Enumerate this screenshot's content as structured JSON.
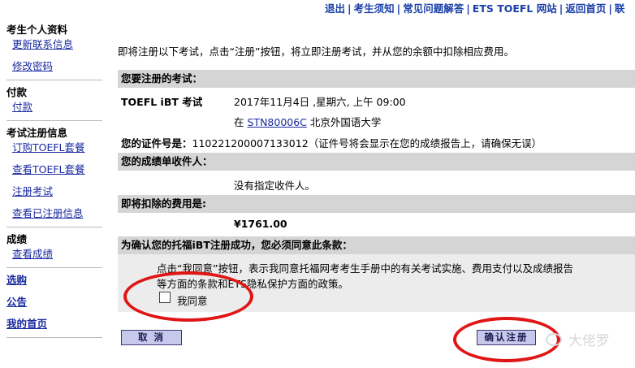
{
  "topnav": [
    "退出",
    "考生须知",
    "常见问题解答",
    "ETS TOEFL 网站",
    "返回首页",
    "联"
  ],
  "sidebar": {
    "profile_head": "考生个人资料",
    "update_contact": "更新联系信息",
    "change_password": "修改密码",
    "payment_head": "付款",
    "pay": "付款",
    "register_head": "考试注册信息",
    "order_toefl": "订购TOEFL套餐",
    "view_toefl": "查看TOEFL套餐",
    "register_exam": "注册考试",
    "view_registered": "查看已注册信息",
    "scores_head": "成绩",
    "view_scores": "查看成绩",
    "elective": "选购",
    "notice": "公告",
    "my_home": "我的首页"
  },
  "main": {
    "intro": "即将注册以下考试，点击“注册”按钮，将立即注册考试，并从您的余额中扣除相应费用。",
    "exam_head": "您要注册的考试：",
    "exam_name": "TOEFL iBT 考试",
    "exam_datetime": "2017年11月4日 ,星期六, 上午 09:00",
    "at": "在",
    "center_code": "STN80006C",
    "center_name": "北京外国语大学",
    "id_label": "您的证件号是：",
    "id_value": "110221200007133012（证件号将会显示在您的成绩报告上，请确保无误）",
    "recipients_head": "您的成绩单收件人：",
    "recipients_value": "没有指定收件人。",
    "fee_head": "即将扣除的费用是:",
    "fee_value": "¥1761.00",
    "agree_head": "为确认您的托福iBT注册成功，您必须同意此条款：",
    "agree_line1": "点击“我同意”按钮，表示我同意托福网考考生手册中的有关考试实施、费用支付以及成绩报告",
    "agree_line2": "等方面的条款和ETS隐私保护方面的政策。",
    "agree_checkbox": "我同意"
  },
  "buttons": {
    "cancel": "取 消",
    "confirm": "确认注册"
  },
  "watermark": "大佬罗",
  "colors": {
    "link": "#1a2aa0",
    "bar": "#d5d5d5",
    "button": "#c8c8ec",
    "annotation": "#e01515"
  }
}
